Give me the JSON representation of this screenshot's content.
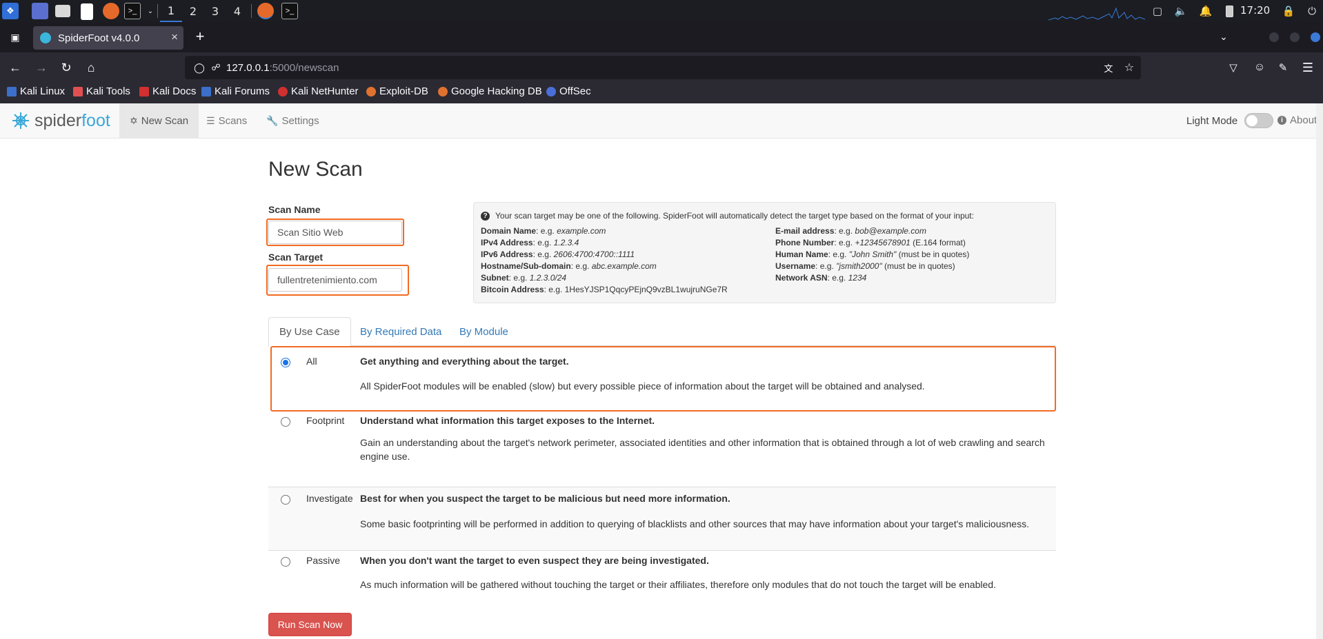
{
  "os": {
    "workspaces": [
      "1",
      "2",
      "3",
      "4"
    ],
    "active_workspace": "1",
    "clock": "17:20"
  },
  "browser": {
    "tab_title": "SpiderFoot v4.0.0",
    "url_host": "127.0.0.1",
    "url_path": ":5000/newscan",
    "bookmarks": [
      {
        "label": "Kali Linux",
        "icon": "kali-icon",
        "color": "#3b6fc9"
      },
      {
        "label": "Kali Tools",
        "icon": "kali-tools-icon",
        "color": "#e05050"
      },
      {
        "label": "Kali Docs",
        "icon": "kali-docs-icon",
        "color": "#d03030"
      },
      {
        "label": "Kali Forums",
        "icon": "kali-forums-icon",
        "color": "#3b6fc9"
      },
      {
        "label": "Kali NetHunter",
        "icon": "nethunter-icon",
        "color": "#d03030"
      },
      {
        "label": "Exploit-DB",
        "icon": "exploit-db-icon",
        "color": "#e0722f"
      },
      {
        "label": "Google Hacking DB",
        "icon": "ghdb-icon",
        "color": "#e0722f"
      },
      {
        "label": "OffSec",
        "icon": "offsec-icon",
        "color": "#4a6fd8"
      }
    ]
  },
  "app": {
    "logo_part1": "spider",
    "logo_part2": "foot",
    "nav": [
      {
        "label": "New Scan",
        "icon": "crosshair-icon"
      },
      {
        "label": "Scans",
        "icon": "list-icon"
      },
      {
        "label": "Settings",
        "icon": "wrench-icon"
      }
    ],
    "light_mode_label": "Light Mode",
    "about_label": "About"
  },
  "form": {
    "title": "New Scan",
    "scan_name_label": "Scan Name",
    "scan_name_value": "Scan Sitio Web",
    "scan_target_label": "Scan Target",
    "scan_target_value": "fullentretenimiento.com",
    "run_button": "Run Scan Now"
  },
  "info": {
    "heading": "Your scan target may be one of the following. SpiderFoot will automatically detect the target type based on the format of your input:",
    "left": [
      {
        "key": "Domain Name",
        "sep": ": e.g. ",
        "example": "example.com",
        "suffix": ""
      },
      {
        "key": "IPv4 Address",
        "sep": ": e.g. ",
        "example": "1.2.3.4",
        "suffix": ""
      },
      {
        "key": "IPv6 Address",
        "sep": ": e.g. ",
        "example": "2606:4700:4700::1111",
        "suffix": ""
      },
      {
        "key": "Hostname/Sub-domain",
        "sep": ": e.g. ",
        "example": "abc.example.com",
        "suffix": ""
      },
      {
        "key": "Subnet",
        "sep": ": e.g. ",
        "example": "1.2.3.0/24",
        "suffix": ""
      },
      {
        "key": "Bitcoin Address",
        "sep": ": e.g. ",
        "example": "",
        "suffix": "1HesYJSP1QqcyPEjnQ9vzBL1wujruNGe7R"
      }
    ],
    "right": [
      {
        "key": "E-mail address",
        "sep": ": e.g. ",
        "example": "bob@example.com",
        "suffix": ""
      },
      {
        "key": "Phone Number",
        "sep": ": e.g. ",
        "example": "+12345678901",
        "suffix": " (E.164 format)"
      },
      {
        "key": "Human Name",
        "sep": ": e.g. ",
        "example": "\"John Smith\"",
        "suffix": " (must be in quotes)"
      },
      {
        "key": "Username",
        "sep": ": e.g. ",
        "example": "\"jsmith2000\"",
        "suffix": " (must be in quotes)"
      },
      {
        "key": "Network ASN",
        "sep": ": e.g. ",
        "example": "1234",
        "suffix": ""
      }
    ]
  },
  "tabs": [
    "By Use Case",
    "By Required Data",
    "By Module"
  ],
  "use_cases": [
    {
      "name": "All",
      "heading": "Get anything and everything about the target.",
      "description": "All SpiderFoot modules will be enabled (slow) but every possible piece of information about the target will be obtained and analysed.",
      "checked": true
    },
    {
      "name": "Footprint",
      "heading": "Understand what information this target exposes to the Internet.",
      "description": "Gain an understanding about the target's network perimeter, associated identities and other information that is obtained through a lot of web crawling and search engine use.",
      "checked": false
    },
    {
      "name": "Investigate",
      "heading": "Best for when you suspect the target to be malicious but need more information.",
      "description": "Some basic footprinting will be performed in addition to querying of blacklists and other sources that may have information about your target's maliciousness.",
      "checked": false
    },
    {
      "name": "Passive",
      "heading": "When you don't want the target to even suspect they are being investigated.",
      "description": "As much information will be gathered without touching the target or their affiliates, therefore only modules that do not touch the target will be enabled.",
      "checked": false
    }
  ],
  "colors": {
    "highlight": "#f26b21",
    "link": "#337ab7",
    "danger": "#d9534f",
    "logo_accent": "#3aa8d8"
  }
}
